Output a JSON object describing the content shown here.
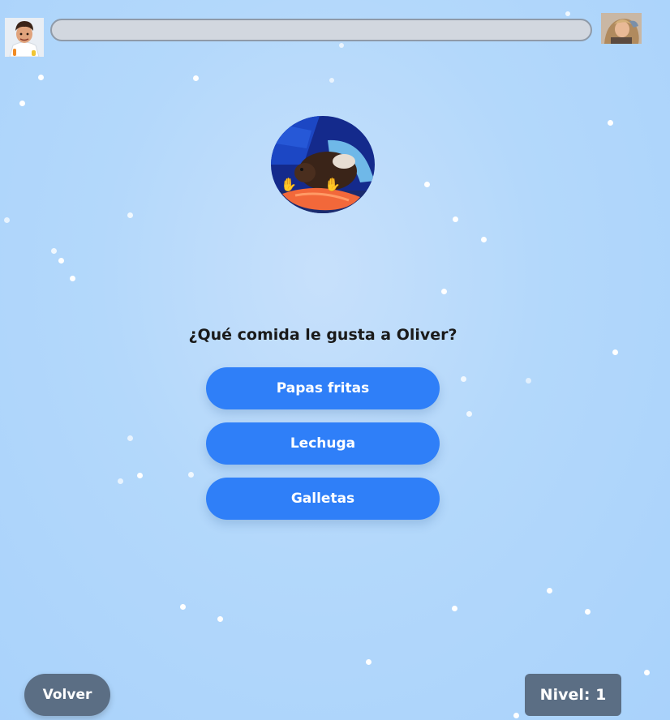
{
  "header": {
    "left_avatar_icon": "chef-avatar-icon",
    "right_avatar_icon": "woman-avatar-icon",
    "progress": 0.0,
    "progress_color": "#2f7ff8"
  },
  "quiz": {
    "pet_photo_icon": "guinea-pig-photo",
    "question": "¿Qué comida le gusta a Oliver?",
    "answers": [
      "Papas fritas",
      "Lechuga",
      "Galletas"
    ],
    "button_color": "#2f7ff8"
  },
  "footer": {
    "back_label": "Volver",
    "level_label": "Nivel: 1"
  }
}
